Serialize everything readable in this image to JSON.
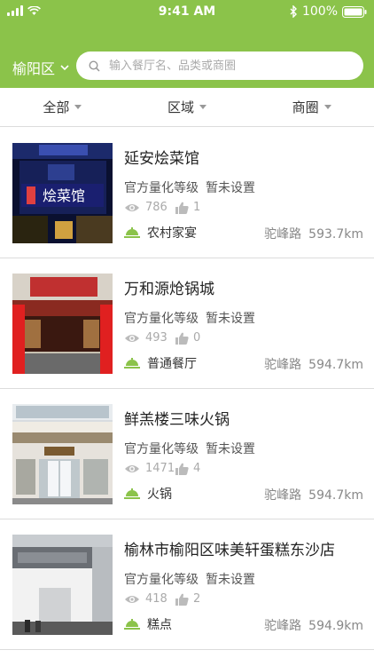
{
  "status_bar": {
    "time": "9:41 AM",
    "battery": "100%"
  },
  "header": {
    "district": "榆阳区",
    "search_placeholder": "输入餐厅名、品类或商圈"
  },
  "filters": [
    {
      "label": "全部"
    },
    {
      "label": "区域"
    },
    {
      "label": "商圈"
    }
  ],
  "grade_label": "官方量化等级",
  "grade_value": "暂未设置",
  "restaurants": [
    {
      "name": "延安烩菜馆",
      "views": "786",
      "likes": "1",
      "category": "农村家宴",
      "street": "驼峰路",
      "distance": "593.7km",
      "sign_text": "烩菜馆"
    },
    {
      "name": "万和源炝锅城",
      "views": "493",
      "likes": "0",
      "category": "普通餐厅",
      "street": "驼峰路",
      "distance": "594.7km"
    },
    {
      "name": "鲜羔楼三味火锅",
      "views": "1471",
      "likes": "4",
      "category": "火锅",
      "street": "驼峰路",
      "distance": "594.7km"
    },
    {
      "name": "榆林市榆阳区味美轩蛋糕东沙店",
      "views": "418",
      "likes": "2",
      "category": "糕点",
      "street": "驼峰路",
      "distance": "594.9km"
    }
  ],
  "colors": {
    "brand_green": "#8bc34a",
    "category_icon": "#8bc34a"
  },
  "icons": {
    "views": "eye-icon",
    "likes": "thumb-up-icon",
    "category": "food-tray-icon"
  }
}
